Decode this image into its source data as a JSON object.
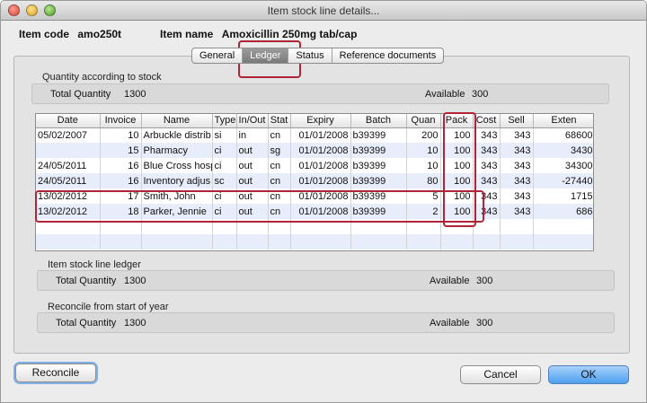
{
  "window": {
    "title": "Item stock line details..."
  },
  "header": {
    "item_code_label": "Item code",
    "item_code": "amo250t",
    "item_name_label": "Item name",
    "item_name": "Amoxicillin 250mg tab/cap"
  },
  "tabs": [
    {
      "label": "General"
    },
    {
      "label": "Ledger"
    },
    {
      "label": "Status"
    },
    {
      "label": "Reference documents"
    }
  ],
  "stock_section": {
    "label": "Quantity according to stock",
    "total_label": "Total Quantity",
    "total_value": "1300",
    "available_label": "Available",
    "available_value": "300"
  },
  "ledger_table": {
    "columns": [
      "Date",
      "Invoice",
      "Name",
      "Type",
      "In/Out",
      "Stat",
      "Expiry",
      "Batch",
      "Quan",
      "Pack",
      "Cost",
      "Sell",
      "Exten"
    ],
    "rows": [
      {
        "date": "05/02/2007",
        "invoice": "10",
        "name": "Arbuckle distrib",
        "type": "si",
        "inout": "in",
        "stat": "cn",
        "expiry": "01/01/2008",
        "batch": "b39399",
        "quan": "200",
        "pack": "100",
        "cost": "343",
        "sell": "343",
        "exten": "68600"
      },
      {
        "date": "",
        "invoice": "15",
        "name": "Pharmacy",
        "type": "ci",
        "inout": "out",
        "stat": "sg",
        "expiry": "01/01/2008",
        "batch": "b39399",
        "quan": "10",
        "pack": "100",
        "cost": "343",
        "sell": "343",
        "exten": "3430"
      },
      {
        "date": "24/05/2011",
        "invoice": "16",
        "name": "Blue Cross hosp",
        "type": "ci",
        "inout": "out",
        "stat": "cn",
        "expiry": "01/01/2008",
        "batch": "b39399",
        "quan": "10",
        "pack": "100",
        "cost": "343",
        "sell": "343",
        "exten": "34300"
      },
      {
        "date": "24/05/2011",
        "invoice": "16",
        "name": "Inventory adjus",
        "type": "sc",
        "inout": "out",
        "stat": "cn",
        "expiry": "01/01/2008",
        "batch": "b39399",
        "quan": "80",
        "pack": "100",
        "cost": "343",
        "sell": "343",
        "exten": "-27440"
      },
      {
        "date": "13/02/2012",
        "invoice": "17",
        "name": "Smith, John",
        "type": "ci",
        "inout": "out",
        "stat": "cn",
        "expiry": "01/01/2008",
        "batch": "b39399",
        "quan": "5",
        "pack": "100",
        "cost": "343",
        "sell": "343",
        "exten": "1715"
      },
      {
        "date": "13/02/2012",
        "invoice": "18",
        "name": "Parker, Jennie",
        "type": "ci",
        "inout": "out",
        "stat": "cn",
        "expiry": "01/01/2008",
        "batch": "b39399",
        "quan": "2",
        "pack": "100",
        "cost": "343",
        "sell": "343",
        "exten": "686"
      }
    ]
  },
  "ledger_section": {
    "label": "Item stock line ledger",
    "total_label": "Total Quantity",
    "total_value": "1300",
    "available_label": "Available",
    "available_value": "300"
  },
  "reconcile_section": {
    "label": "Reconcile from start of year",
    "total_label": "Total Quantity",
    "total_value": "1300",
    "available_label": "Available",
    "available_value": "300"
  },
  "buttons": {
    "reconcile": "Reconcile",
    "cancel": "Cancel",
    "ok": "OK"
  },
  "colors": {
    "highlight": "#b0243a",
    "default_button": "#4d9ff0",
    "alt_row": "#e8edfb"
  }
}
